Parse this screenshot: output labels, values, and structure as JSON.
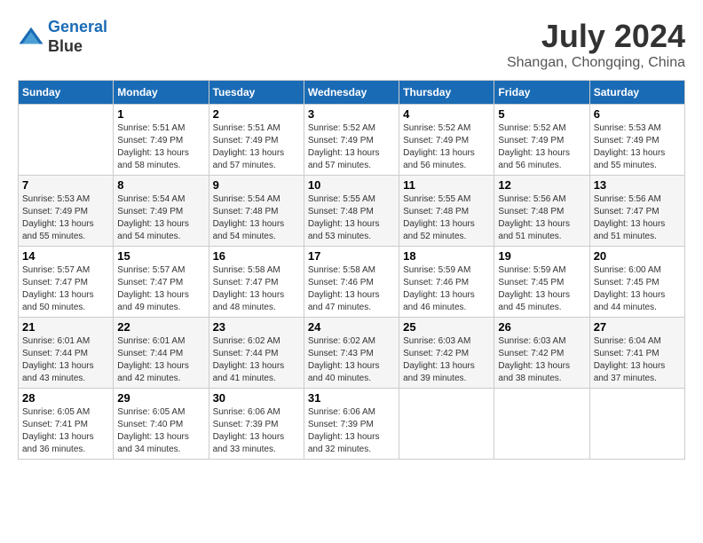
{
  "header": {
    "logo_line1": "General",
    "logo_line2": "Blue",
    "month": "July 2024",
    "location": "Shangan, Chongqing, China"
  },
  "weekdays": [
    "Sunday",
    "Monday",
    "Tuesday",
    "Wednesday",
    "Thursday",
    "Friday",
    "Saturday"
  ],
  "weeks": [
    [
      {
        "day": "",
        "sunrise": "",
        "sunset": "",
        "daylight": ""
      },
      {
        "day": "1",
        "sunrise": "Sunrise: 5:51 AM",
        "sunset": "Sunset: 7:49 PM",
        "daylight": "Daylight: 13 hours and 58 minutes."
      },
      {
        "day": "2",
        "sunrise": "Sunrise: 5:51 AM",
        "sunset": "Sunset: 7:49 PM",
        "daylight": "Daylight: 13 hours and 57 minutes."
      },
      {
        "day": "3",
        "sunrise": "Sunrise: 5:52 AM",
        "sunset": "Sunset: 7:49 PM",
        "daylight": "Daylight: 13 hours and 57 minutes."
      },
      {
        "day": "4",
        "sunrise": "Sunrise: 5:52 AM",
        "sunset": "Sunset: 7:49 PM",
        "daylight": "Daylight: 13 hours and 56 minutes."
      },
      {
        "day": "5",
        "sunrise": "Sunrise: 5:52 AM",
        "sunset": "Sunset: 7:49 PM",
        "daylight": "Daylight: 13 hours and 56 minutes."
      },
      {
        "day": "6",
        "sunrise": "Sunrise: 5:53 AM",
        "sunset": "Sunset: 7:49 PM",
        "daylight": "Daylight: 13 hours and 55 minutes."
      }
    ],
    [
      {
        "day": "7",
        "sunrise": "Sunrise: 5:53 AM",
        "sunset": "Sunset: 7:49 PM",
        "daylight": "Daylight: 13 hours and 55 minutes."
      },
      {
        "day": "8",
        "sunrise": "Sunrise: 5:54 AM",
        "sunset": "Sunset: 7:49 PM",
        "daylight": "Daylight: 13 hours and 54 minutes."
      },
      {
        "day": "9",
        "sunrise": "Sunrise: 5:54 AM",
        "sunset": "Sunset: 7:48 PM",
        "daylight": "Daylight: 13 hours and 54 minutes."
      },
      {
        "day": "10",
        "sunrise": "Sunrise: 5:55 AM",
        "sunset": "Sunset: 7:48 PM",
        "daylight": "Daylight: 13 hours and 53 minutes."
      },
      {
        "day": "11",
        "sunrise": "Sunrise: 5:55 AM",
        "sunset": "Sunset: 7:48 PM",
        "daylight": "Daylight: 13 hours and 52 minutes."
      },
      {
        "day": "12",
        "sunrise": "Sunrise: 5:56 AM",
        "sunset": "Sunset: 7:48 PM",
        "daylight": "Daylight: 13 hours and 51 minutes."
      },
      {
        "day": "13",
        "sunrise": "Sunrise: 5:56 AM",
        "sunset": "Sunset: 7:47 PM",
        "daylight": "Daylight: 13 hours and 51 minutes."
      }
    ],
    [
      {
        "day": "14",
        "sunrise": "Sunrise: 5:57 AM",
        "sunset": "Sunset: 7:47 PM",
        "daylight": "Daylight: 13 hours and 50 minutes."
      },
      {
        "day": "15",
        "sunrise": "Sunrise: 5:57 AM",
        "sunset": "Sunset: 7:47 PM",
        "daylight": "Daylight: 13 hours and 49 minutes."
      },
      {
        "day": "16",
        "sunrise": "Sunrise: 5:58 AM",
        "sunset": "Sunset: 7:47 PM",
        "daylight": "Daylight: 13 hours and 48 minutes."
      },
      {
        "day": "17",
        "sunrise": "Sunrise: 5:58 AM",
        "sunset": "Sunset: 7:46 PM",
        "daylight": "Daylight: 13 hours and 47 minutes."
      },
      {
        "day": "18",
        "sunrise": "Sunrise: 5:59 AM",
        "sunset": "Sunset: 7:46 PM",
        "daylight": "Daylight: 13 hours and 46 minutes."
      },
      {
        "day": "19",
        "sunrise": "Sunrise: 5:59 AM",
        "sunset": "Sunset: 7:45 PM",
        "daylight": "Daylight: 13 hours and 45 minutes."
      },
      {
        "day": "20",
        "sunrise": "Sunrise: 6:00 AM",
        "sunset": "Sunset: 7:45 PM",
        "daylight": "Daylight: 13 hours and 44 minutes."
      }
    ],
    [
      {
        "day": "21",
        "sunrise": "Sunrise: 6:01 AM",
        "sunset": "Sunset: 7:44 PM",
        "daylight": "Daylight: 13 hours and 43 minutes."
      },
      {
        "day": "22",
        "sunrise": "Sunrise: 6:01 AM",
        "sunset": "Sunset: 7:44 PM",
        "daylight": "Daylight: 13 hours and 42 minutes."
      },
      {
        "day": "23",
        "sunrise": "Sunrise: 6:02 AM",
        "sunset": "Sunset: 7:44 PM",
        "daylight": "Daylight: 13 hours and 41 minutes."
      },
      {
        "day": "24",
        "sunrise": "Sunrise: 6:02 AM",
        "sunset": "Sunset: 7:43 PM",
        "daylight": "Daylight: 13 hours and 40 minutes."
      },
      {
        "day": "25",
        "sunrise": "Sunrise: 6:03 AM",
        "sunset": "Sunset: 7:42 PM",
        "daylight": "Daylight: 13 hours and 39 minutes."
      },
      {
        "day": "26",
        "sunrise": "Sunrise: 6:03 AM",
        "sunset": "Sunset: 7:42 PM",
        "daylight": "Daylight: 13 hours and 38 minutes."
      },
      {
        "day": "27",
        "sunrise": "Sunrise: 6:04 AM",
        "sunset": "Sunset: 7:41 PM",
        "daylight": "Daylight: 13 hours and 37 minutes."
      }
    ],
    [
      {
        "day": "28",
        "sunrise": "Sunrise: 6:05 AM",
        "sunset": "Sunset: 7:41 PM",
        "daylight": "Daylight: 13 hours and 36 minutes."
      },
      {
        "day": "29",
        "sunrise": "Sunrise: 6:05 AM",
        "sunset": "Sunset: 7:40 PM",
        "daylight": "Daylight: 13 hours and 34 minutes."
      },
      {
        "day": "30",
        "sunrise": "Sunrise: 6:06 AM",
        "sunset": "Sunset: 7:39 PM",
        "daylight": "Daylight: 13 hours and 33 minutes."
      },
      {
        "day": "31",
        "sunrise": "Sunrise: 6:06 AM",
        "sunset": "Sunset: 7:39 PM",
        "daylight": "Daylight: 13 hours and 32 minutes."
      },
      {
        "day": "",
        "sunrise": "",
        "sunset": "",
        "daylight": ""
      },
      {
        "day": "",
        "sunrise": "",
        "sunset": "",
        "daylight": ""
      },
      {
        "day": "",
        "sunrise": "",
        "sunset": "",
        "daylight": ""
      }
    ]
  ]
}
